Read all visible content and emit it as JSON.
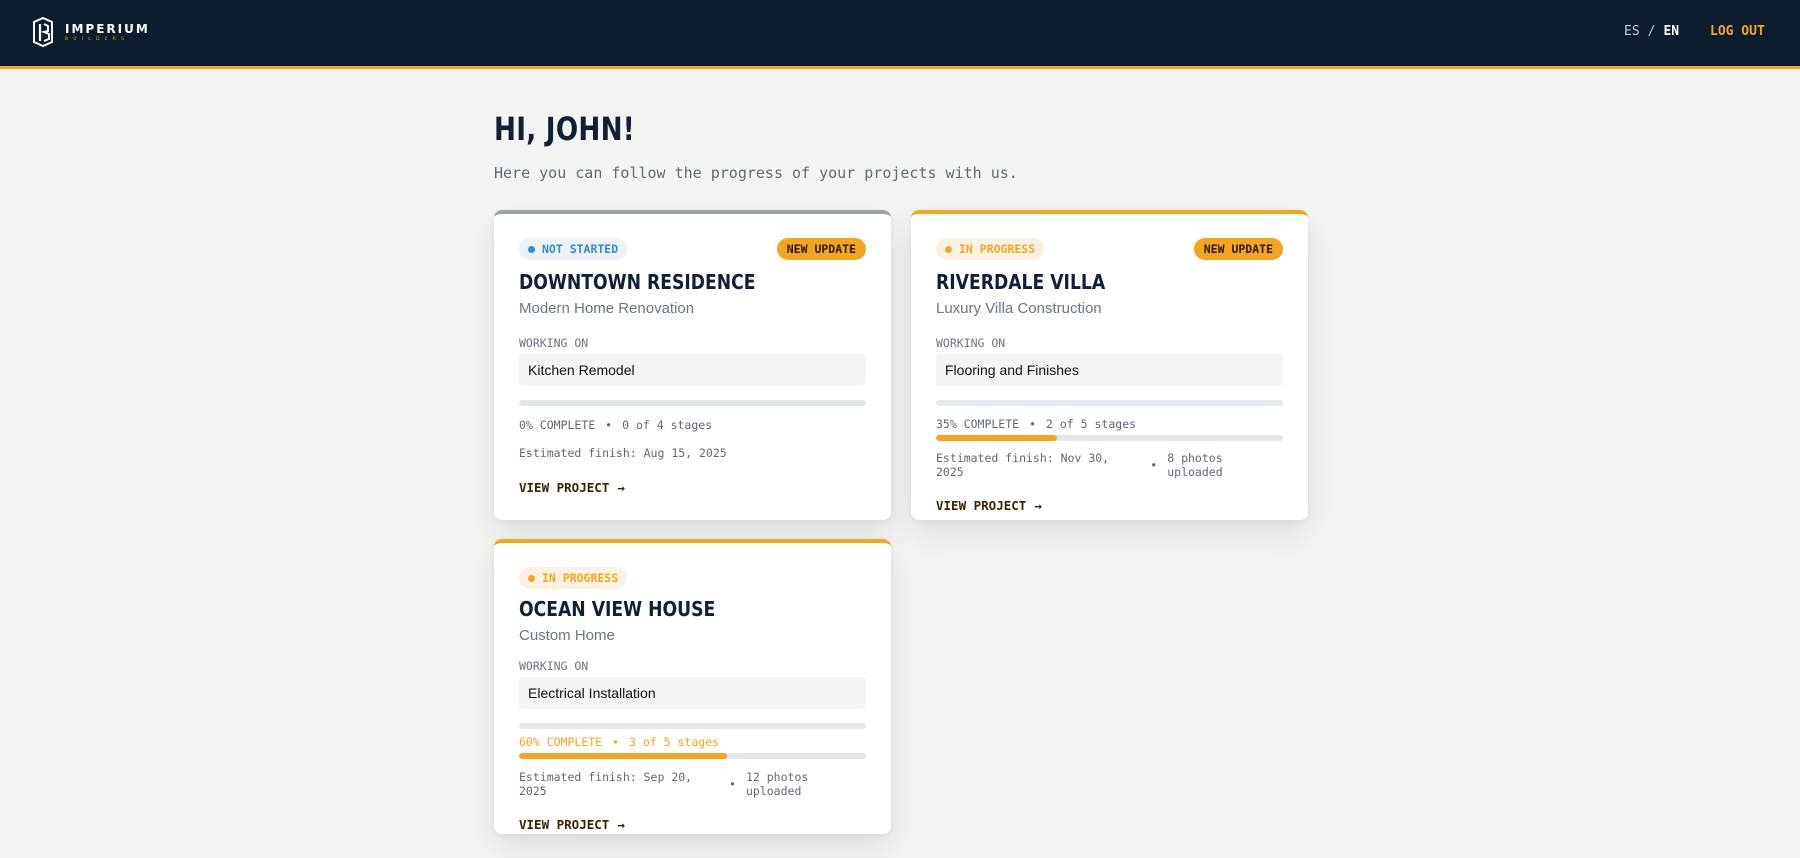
{
  "header": {
    "logo_name": "IMPERIUM",
    "logo_sub": "BUILDERS",
    "lang_es": "ES",
    "lang_sep": "/",
    "lang_en": "EN",
    "logout": "LOG OUT"
  },
  "greeting": "HI, JOHN!",
  "intro": "Here you can follow the progress of your projects with us.",
  "colors": {
    "navy": "#0e1d2d",
    "accent": "#f3a51e",
    "blue_status": "#2b8fd0"
  },
  "projects": [
    {
      "status": "NOT STARTED",
      "badge": "NEW UPDATE",
      "name": "DOWNTOWN RESIDENCE",
      "type": "Modern Home Renovation",
      "working_label": "WORKING ON",
      "working_on": "Kitchen Remodel",
      "progress_text": "0% COMPLETE",
      "progress": 0,
      "stages": "0 of 4 stages",
      "finish": "Estimated finish: Aug 15, 2025",
      "cta": "VIEW PROJECT",
      "cta_arrow": "→"
    },
    {
      "status": "IN PROGRESS",
      "badge": "NEW UPDATE",
      "name": "RIVERDALE VILLA",
      "type": "Luxury Villa Construction",
      "working_label": "WORKING ON",
      "working_on": "Flooring and Finishes",
      "progress_text": "35% COMPLETE",
      "progress": 35,
      "stages": "2 of 5 stages",
      "finish": "Estimated finish: Nov 30, 2025",
      "photos": "8 photos uploaded",
      "cta": "VIEW PROJECT",
      "cta_arrow": "→"
    },
    {
      "status": "IN PROGRESS",
      "name": "OCEAN VIEW HOUSE",
      "type": "Custom Home",
      "working_label": "WORKING ON",
      "working_on": "Electrical Installation",
      "progress_text": "60% COMPLETE",
      "progress": 60,
      "stages": "3 of 5 stages",
      "finish": "Estimated finish: Sep 20, 2025",
      "photos": "12 photos uploaded",
      "cta": "VIEW PROJECT",
      "cta_arrow": "→"
    }
  ]
}
